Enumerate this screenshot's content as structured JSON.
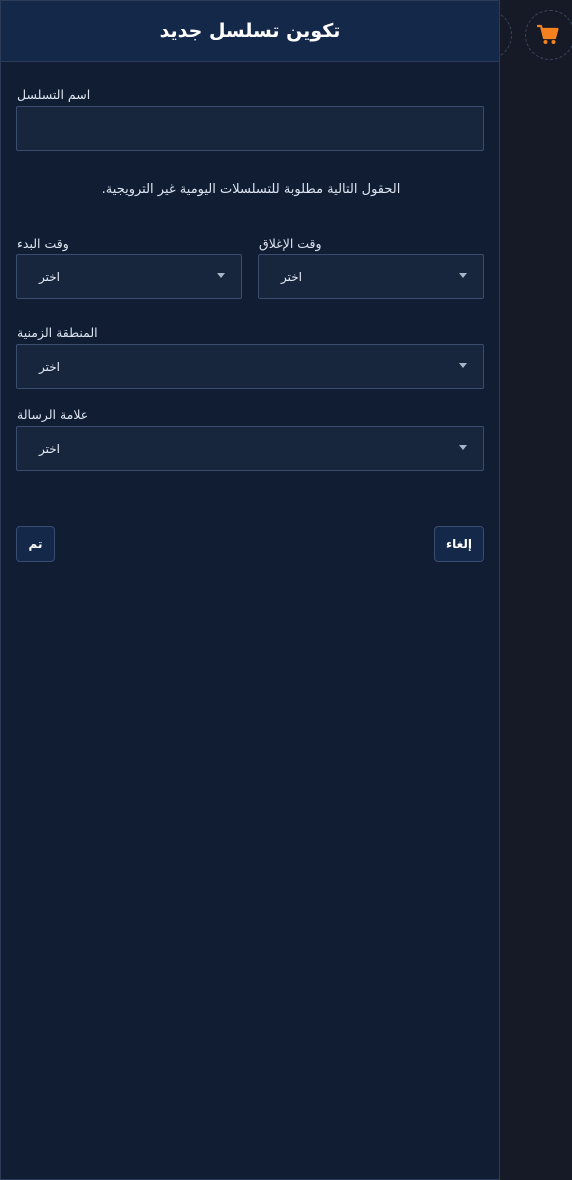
{
  "panel": {
    "title": "تكوين تسلسل جديد"
  },
  "form": {
    "sequence_name": {
      "label": "اسم التسلسل",
      "value": "",
      "placeholder": ""
    },
    "info": ".الحقول التالية مطلوبة للتسلسلات اليومية غير الترويجية",
    "close_time": {
      "label": "وقت الإغلاق",
      "selected": "اختر"
    },
    "start_time": {
      "label": "وقت البدء",
      "selected": "اختر"
    },
    "timezone": {
      "label": "المنطقة الزمنية",
      "selected": "اختر"
    },
    "message_tag": {
      "label": "علامة الرسالة",
      "selected": "اختر"
    }
  },
  "actions": {
    "cancel_label": "إلغاء",
    "done_label": "تم"
  },
  "icons": {
    "cart": "shopping-cart-icon"
  },
  "colors": {
    "panel_bg": "#101d33",
    "header_bg": "#14284a",
    "accent": "#f5821f"
  }
}
